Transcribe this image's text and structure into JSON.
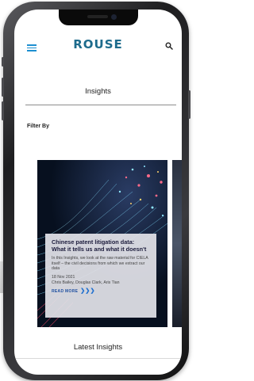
{
  "header": {
    "logo": "ROUSE",
    "menu_icon": "hamburger-menu-icon",
    "search_icon": "search-icon",
    "accent_color": "#1d8fd0",
    "logo_color": "#1d6b8c"
  },
  "insights": {
    "title": "Insights",
    "filter_label": "Filter By"
  },
  "card": {
    "title": "Chinese patent litigation data: What it tells us and what it doesn't",
    "description": "In this Insights, we look at the raw material for CIELA itself – the civil decisions from which we extract our data",
    "date": "18 Nov 2021",
    "authors": "Chris Bailey, Douglas Clark, Aris Tian",
    "read_more": "READ MORE",
    "arrows": "❯❯❯"
  },
  "latest": {
    "title": "Latest Insights"
  }
}
